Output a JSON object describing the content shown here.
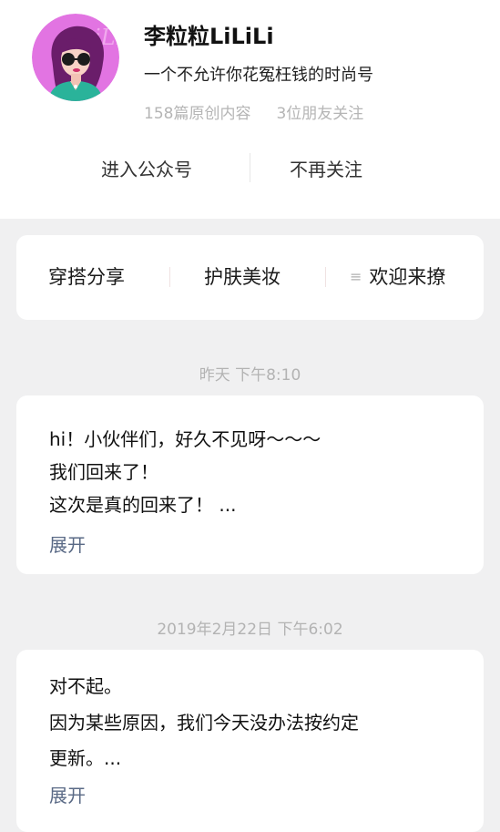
{
  "profile": {
    "name": "李粒粒LiLiLi",
    "description": "一个不允许你花冤枉钱的时尚号",
    "original_count": "158篇原创内容",
    "friends_following": "3位朋友关注",
    "avatar_text": "LiLi"
  },
  "actions": {
    "enter": "进入公众号",
    "unfollow": "不再关注"
  },
  "menu": {
    "items": [
      {
        "label": "穿搭分享"
      },
      {
        "label": "护肤美妆"
      },
      {
        "label": "欢迎来撩",
        "icon": "menu-icon"
      }
    ]
  },
  "posts": [
    {
      "timestamp": "昨天 下午8:10",
      "lines": [
        "hi！小伙伴们，好久不见呀～～～",
        "我们回来了！",
        "这次是真的回来了！ ..."
      ],
      "expand": "展开"
    },
    {
      "timestamp": "2019年2月22日 下午6:02",
      "lines": [
        "对不起。",
        "因为某些原因，我们今天没办法按约定",
        "更新。..."
      ],
      "expand": "展开"
    }
  ],
  "colors": {
    "background": "#f0f0f1",
    "card": "#ffffff",
    "link": "#5a6a86",
    "muted": "#b3b3b3",
    "avatar_bg": "#e274e2"
  }
}
